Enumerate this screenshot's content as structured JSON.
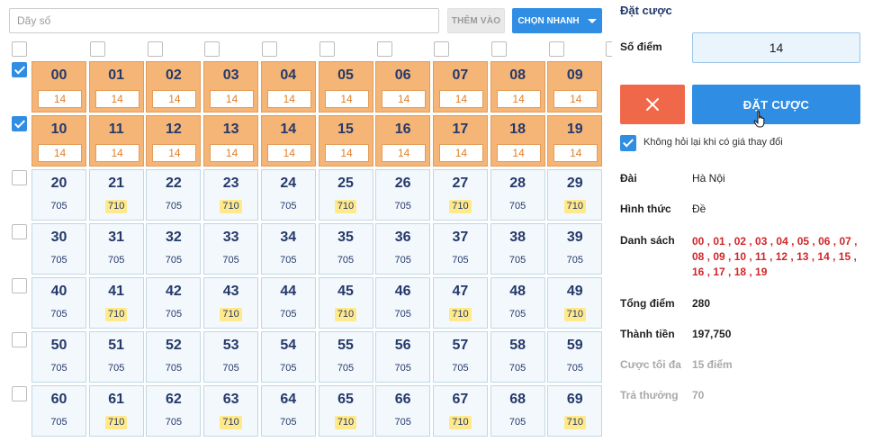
{
  "toolbar": {
    "search_placeholder": "Dãy số",
    "search_value": "",
    "add_label": "THÊM VÀO",
    "quick_label": "CHỌN NHANH"
  },
  "grid": {
    "column_checks": [
      false,
      false,
      false,
      false,
      false,
      false,
      false,
      false,
      false,
      false
    ],
    "rows": [
      {
        "checked": true,
        "cells": [
          {
            "num": "00",
            "selected": true,
            "points": "14"
          },
          {
            "num": "01",
            "selected": true,
            "points": "14"
          },
          {
            "num": "02",
            "selected": true,
            "points": "14"
          },
          {
            "num": "03",
            "selected": true,
            "points": "14"
          },
          {
            "num": "04",
            "selected": true,
            "points": "14"
          },
          {
            "num": "05",
            "selected": true,
            "points": "14"
          },
          {
            "num": "06",
            "selected": true,
            "points": "14"
          },
          {
            "num": "07",
            "selected": true,
            "points": "14"
          },
          {
            "num": "08",
            "selected": true,
            "points": "14"
          },
          {
            "num": "09",
            "selected": true,
            "points": "14"
          }
        ]
      },
      {
        "checked": true,
        "cells": [
          {
            "num": "10",
            "selected": true,
            "points": "14"
          },
          {
            "num": "11",
            "selected": true,
            "points": "14"
          },
          {
            "num": "12",
            "selected": true,
            "points": "14"
          },
          {
            "num": "13",
            "selected": true,
            "points": "14"
          },
          {
            "num": "14",
            "selected": true,
            "points": "14"
          },
          {
            "num": "15",
            "selected": true,
            "points": "14"
          },
          {
            "num": "16",
            "selected": true,
            "points": "14"
          },
          {
            "num": "17",
            "selected": true,
            "points": "14"
          },
          {
            "num": "18",
            "selected": true,
            "points": "14"
          },
          {
            "num": "19",
            "selected": true,
            "points": "14"
          }
        ]
      },
      {
        "checked": false,
        "cells": [
          {
            "num": "20",
            "price": "705"
          },
          {
            "num": "21",
            "price": "710",
            "hl": true
          },
          {
            "num": "22",
            "price": "705"
          },
          {
            "num": "23",
            "price": "710",
            "hl": true
          },
          {
            "num": "24",
            "price": "705"
          },
          {
            "num": "25",
            "price": "710",
            "hl": true
          },
          {
            "num": "26",
            "price": "705"
          },
          {
            "num": "27",
            "price": "710",
            "hl": true
          },
          {
            "num": "28",
            "price": "705"
          },
          {
            "num": "29",
            "price": "710",
            "hl": true
          }
        ]
      },
      {
        "checked": false,
        "cells": [
          {
            "num": "30",
            "price": "705"
          },
          {
            "num": "31",
            "price": "705"
          },
          {
            "num": "32",
            "price": "705"
          },
          {
            "num": "33",
            "price": "705"
          },
          {
            "num": "34",
            "price": "705"
          },
          {
            "num": "35",
            "price": "705"
          },
          {
            "num": "36",
            "price": "705"
          },
          {
            "num": "37",
            "price": "705"
          },
          {
            "num": "38",
            "price": "705"
          },
          {
            "num": "39",
            "price": "705"
          }
        ]
      },
      {
        "checked": false,
        "cells": [
          {
            "num": "40",
            "price": "705"
          },
          {
            "num": "41",
            "price": "710",
            "hl": true
          },
          {
            "num": "42",
            "price": "705"
          },
          {
            "num": "43",
            "price": "710",
            "hl": true
          },
          {
            "num": "44",
            "price": "705"
          },
          {
            "num": "45",
            "price": "710",
            "hl": true
          },
          {
            "num": "46",
            "price": "705"
          },
          {
            "num": "47",
            "price": "710",
            "hl": true
          },
          {
            "num": "48",
            "price": "705"
          },
          {
            "num": "49",
            "price": "710",
            "hl": true
          }
        ]
      },
      {
        "checked": false,
        "cells": [
          {
            "num": "50",
            "price": "705"
          },
          {
            "num": "51",
            "price": "705"
          },
          {
            "num": "52",
            "price": "705"
          },
          {
            "num": "53",
            "price": "705"
          },
          {
            "num": "54",
            "price": "705"
          },
          {
            "num": "55",
            "price": "705"
          },
          {
            "num": "56",
            "price": "705"
          },
          {
            "num": "57",
            "price": "705"
          },
          {
            "num": "58",
            "price": "705"
          },
          {
            "num": "59",
            "price": "705"
          }
        ]
      },
      {
        "checked": false,
        "cells": [
          {
            "num": "60",
            "price": "705"
          },
          {
            "num": "61",
            "price": "710",
            "hl": true
          },
          {
            "num": "62",
            "price": "705"
          },
          {
            "num": "63",
            "price": "710",
            "hl": true
          },
          {
            "num": "64",
            "price": "705"
          },
          {
            "num": "65",
            "price": "710",
            "hl": true
          },
          {
            "num": "66",
            "price": "705"
          },
          {
            "num": "67",
            "price": "710",
            "hl": true
          },
          {
            "num": "68",
            "price": "705"
          },
          {
            "num": "69",
            "price": "710",
            "hl": true
          }
        ]
      }
    ]
  },
  "panel": {
    "title": "Đặt cược",
    "points_label": "Số điểm",
    "points_value": "14",
    "bet_label": "ĐẶT CƯỢC",
    "no_ask_label": "Không hỏi lại khi có giá thay đổi",
    "no_ask_checked": true,
    "dai_label": "Đài",
    "dai_value": "Hà Nội",
    "hinh_thuc_label": "Hình thức",
    "hinh_thuc_value": "Đề",
    "danh_sach_label": "Danh sách",
    "danh_sach_value": "00 , 01 , 02 , 03 , 04 , 05 , 06 , 07 , 08 , 09 , 10 , 11 , 12 , 13 , 14 , 15 , 16 , 17 , 18 , 19",
    "tong_diem_label": "Tổng điểm",
    "tong_diem_value": "280",
    "thanh_tien_label": "Thành tiền",
    "thanh_tien_value": "197,750",
    "cuoc_toi_da_label": "Cược tối đa",
    "cuoc_toi_da_value": "15 điểm",
    "tra_thuong_label": "Trả thưởng",
    "tra_thuong_value": "70"
  },
  "colors": {
    "accent_blue": "#2f8de4",
    "cancel_red": "#f0684a",
    "selected_cell": "#f5b576",
    "highlight_price": "#ffe98a",
    "list_red": "#d0262a",
    "number_navy": "#24396b"
  },
  "icons": {
    "cancel": "close-icon",
    "quick_caret": "caret-down-icon",
    "cursor": "pointer-hand-icon"
  }
}
